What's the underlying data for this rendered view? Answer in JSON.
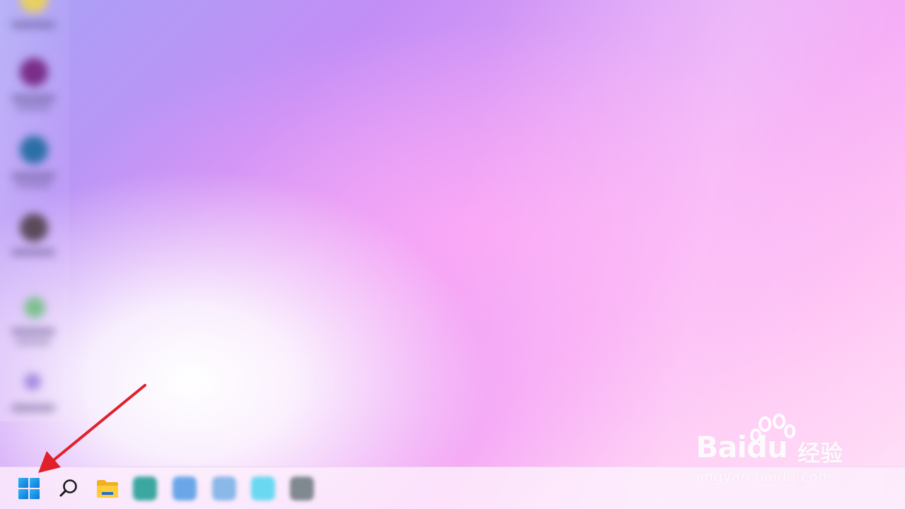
{
  "desktop": {
    "icons": [
      {
        "color": "#e8d060"
      },
      {
        "color": "#7a2e8a"
      },
      {
        "color": "#2b6fa6"
      },
      {
        "color": "#5a4a5a"
      },
      {
        "color": "#7ec090"
      },
      {
        "color": "#a48ce0"
      }
    ]
  },
  "taskbar": {
    "start_color": "#0a78d6",
    "pinned_apps": [
      {
        "icon": "start-icon"
      },
      {
        "icon": "search-icon"
      },
      {
        "icon": "folder-icon"
      },
      {
        "icon": "edge-icon",
        "color": "#3aa7a0"
      },
      {
        "icon": "app-icon",
        "color": "#6aa6e8"
      },
      {
        "icon": "app-icon",
        "color": "#8ab8e8"
      },
      {
        "icon": "app-icon",
        "color": "#6ad8f0"
      },
      {
        "icon": "app-icon",
        "color": "#808890"
      }
    ]
  },
  "annotation": {
    "arrow_color": "#e0202a"
  },
  "watermark": {
    "brand": "Bai",
    "brand_suffix": "du",
    "product": "经验",
    "url": "jingyan.baidu.com"
  }
}
